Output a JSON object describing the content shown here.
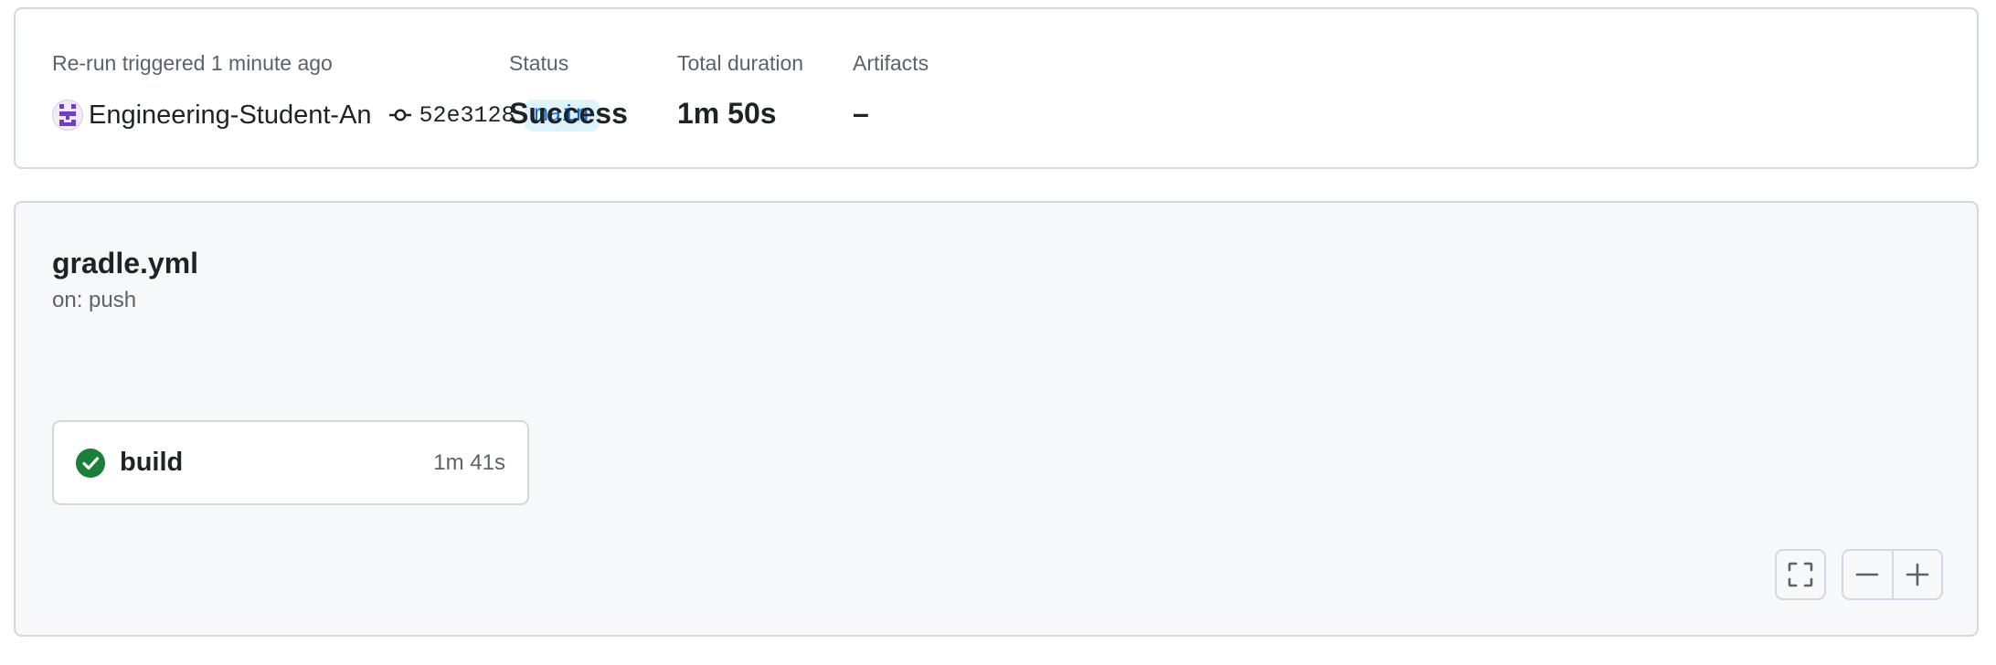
{
  "run_summary": {
    "trigger_text": "Re-run triggered 1 minute ago",
    "actor": {
      "name": "Engineering-Student-An",
      "avatar_icon": "identicon-avatar"
    },
    "commit": {
      "icon": "git-commit-icon",
      "sha": "52e3128"
    },
    "branch": "main",
    "status": {
      "label": "Status",
      "value": "Success"
    },
    "duration": {
      "label": "Total duration",
      "value": "1m 50s"
    },
    "artifacts": {
      "label": "Artifacts",
      "value": "–"
    }
  },
  "workflow": {
    "file": "gradle.yml",
    "trigger": "on: push",
    "jobs": [
      {
        "name": "build",
        "duration": "1m 41s",
        "status": "success",
        "status_icon": "check-circle-icon"
      }
    ],
    "controls": {
      "fullscreen_icon": "fullscreen-icon",
      "zoom_out_icon": "minus-icon",
      "zoom_in_icon": "plus-icon"
    }
  },
  "colors": {
    "success": "#1a7f37",
    "link": "#0969da",
    "branch_bg": "#ddf4ff",
    "muted_text": "#59636e",
    "border": "#d1d9e0",
    "canvas_bg": "#f6f8fa",
    "avatar": "#6e40c9"
  }
}
